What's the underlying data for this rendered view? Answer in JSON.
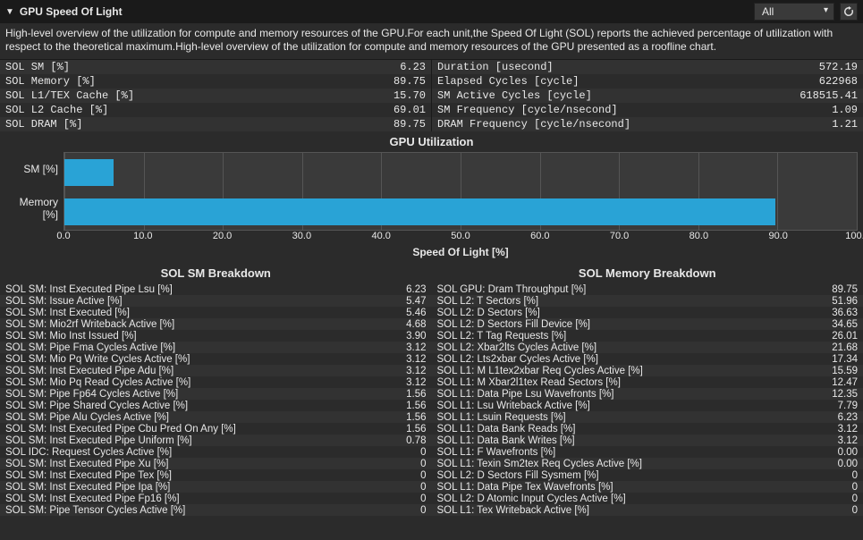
{
  "header": {
    "title": "GPU Speed Of Light",
    "dropdown": "All"
  },
  "description": "High-level overview of the utilization for compute and memory resources of the GPU.For each unit,the Speed Of Light (SOL) reports the achieved percentage of utilization with respect to the theoretical maximum.High-level overview of the utilization for compute and memory resources of the GPU presented as a roofline chart.",
  "metrics_left": [
    {
      "label": "SOL SM [%]",
      "value": "6.23"
    },
    {
      "label": "SOL Memory [%]",
      "value": "89.75"
    },
    {
      "label": "SOL L1/TEX Cache [%]",
      "value": "15.70"
    },
    {
      "label": "SOL L2 Cache [%]",
      "value": "69.01"
    },
    {
      "label": "SOL DRAM [%]",
      "value": "89.75"
    }
  ],
  "metrics_right": [
    {
      "label": "Duration [usecond]",
      "value": "572.19"
    },
    {
      "label": "Elapsed Cycles [cycle]",
      "value": "622968"
    },
    {
      "label": "SM Active Cycles [cycle]",
      "value": "618515.41"
    },
    {
      "label": "SM Frequency [cycle/nsecond]",
      "value": "1.09"
    },
    {
      "label": "DRAM Frequency [cycle/nsecond]",
      "value": "1.21"
    }
  ],
  "chart_data": {
    "type": "bar",
    "title": "GPU Utilization",
    "xlabel": "Speed Of Light [%]",
    "ylabel": "",
    "categories": [
      "SM [%]",
      "Memory [%]"
    ],
    "values": [
      6.23,
      89.75
    ],
    "xlim": [
      0,
      100
    ],
    "xticks": [
      0.0,
      10.0,
      20.0,
      30.0,
      40.0,
      50.0,
      60.0,
      70.0,
      80.0,
      90.0,
      100.0
    ]
  },
  "breakdown_sm": {
    "title": "SOL SM Breakdown",
    "rows": [
      {
        "label": "SOL SM: Inst Executed Pipe Lsu [%]",
        "value": "6.23"
      },
      {
        "label": "SOL SM: Issue Active [%]",
        "value": "5.47"
      },
      {
        "label": "SOL SM: Inst Executed [%]",
        "value": "5.46"
      },
      {
        "label": "SOL SM: Mio2rf Writeback Active [%]",
        "value": "4.68"
      },
      {
        "label": "SOL SM: Mio Inst Issued [%]",
        "value": "3.90"
      },
      {
        "label": "SOL SM: Pipe Fma Cycles Active [%]",
        "value": "3.12"
      },
      {
        "label": "SOL SM: Mio Pq Write Cycles Active [%]",
        "value": "3.12"
      },
      {
        "label": "SOL SM: Inst Executed Pipe Adu [%]",
        "value": "3.12"
      },
      {
        "label": "SOL SM: Mio Pq Read Cycles Active [%]",
        "value": "3.12"
      },
      {
        "label": "SOL SM: Pipe Fp64 Cycles Active [%]",
        "value": "1.56"
      },
      {
        "label": "SOL SM: Pipe Shared Cycles Active [%]",
        "value": "1.56"
      },
      {
        "label": "SOL SM: Pipe Alu Cycles Active [%]",
        "value": "1.56"
      },
      {
        "label": "SOL SM: Inst Executed Pipe Cbu Pred On Any [%]",
        "value": "1.56"
      },
      {
        "label": "SOL SM: Inst Executed Pipe Uniform [%]",
        "value": "0.78"
      },
      {
        "label": "SOL IDC: Request Cycles Active [%]",
        "value": "0"
      },
      {
        "label": "SOL SM: Inst Executed Pipe Xu [%]",
        "value": "0"
      },
      {
        "label": "SOL SM: Inst Executed Pipe Tex [%]",
        "value": "0"
      },
      {
        "label": "SOL SM: Inst Executed Pipe Ipa [%]",
        "value": "0"
      },
      {
        "label": "SOL SM: Inst Executed Pipe Fp16 [%]",
        "value": "0"
      },
      {
        "label": "SOL SM: Pipe Tensor Cycles Active [%]",
        "value": "0"
      }
    ]
  },
  "breakdown_mem": {
    "title": "SOL Memory Breakdown",
    "rows": [
      {
        "label": "SOL GPU: Dram Throughput [%]",
        "value": "89.75"
      },
      {
        "label": "SOL L2: T Sectors [%]",
        "value": "51.96"
      },
      {
        "label": "SOL L2: D Sectors [%]",
        "value": "36.63"
      },
      {
        "label": "SOL L2: D Sectors Fill Device [%]",
        "value": "34.65"
      },
      {
        "label": "SOL L2: T Tag Requests [%]",
        "value": "26.01"
      },
      {
        "label": "SOL L2: Xbar2lts Cycles Active [%]",
        "value": "21.68"
      },
      {
        "label": "SOL L2: Lts2xbar Cycles Active [%]",
        "value": "17.34"
      },
      {
        "label": "SOL L1: M L1tex2xbar Req Cycles Active [%]",
        "value": "15.59"
      },
      {
        "label": "SOL L1: M Xbar2l1tex Read Sectors [%]",
        "value": "12.47"
      },
      {
        "label": "SOL L1: Data Pipe Lsu Wavefronts [%]",
        "value": "12.35"
      },
      {
        "label": "SOL L1: Lsu Writeback Active [%]",
        "value": "7.79"
      },
      {
        "label": "SOL L1: Lsuin Requests [%]",
        "value": "6.23"
      },
      {
        "label": "SOL L1: Data Bank Reads [%]",
        "value": "3.12"
      },
      {
        "label": "SOL L1: Data Bank Writes [%]",
        "value": "3.12"
      },
      {
        "label": "SOL L1: F Wavefronts [%]",
        "value": "0.00"
      },
      {
        "label": "SOL L1: Texin Sm2tex Req Cycles Active [%]",
        "value": "0.00"
      },
      {
        "label": "SOL L2: D Sectors Fill Sysmem [%]",
        "value": "0"
      },
      {
        "label": "SOL L1: Data Pipe Tex Wavefronts [%]",
        "value": "0"
      },
      {
        "label": "SOL L2: D Atomic Input Cycles Active [%]",
        "value": "0"
      },
      {
        "label": "SOL L1: Tex Writeback Active [%]",
        "value": "0"
      }
    ]
  }
}
